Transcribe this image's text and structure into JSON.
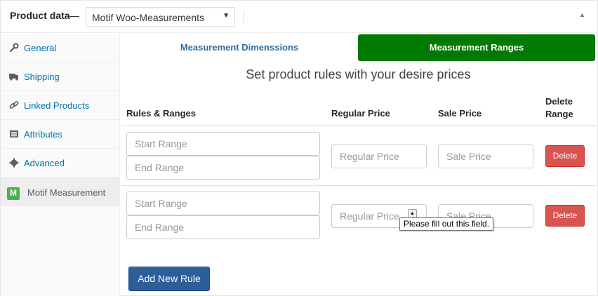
{
  "header": {
    "title": "Product data",
    "dash": "—",
    "product_type": "Motif Woo-Measurements",
    "select_arrow": "▼",
    "toggle_arrow": "▲"
  },
  "sidebar": {
    "items": [
      {
        "label": "General",
        "icon": "wrench-icon"
      },
      {
        "label": "Shipping",
        "icon": "truck-icon"
      },
      {
        "label": "Linked Products",
        "icon": "link-icon"
      },
      {
        "label": "Attributes",
        "icon": "list-icon"
      },
      {
        "label": "Advanced",
        "icon": "gear-icon"
      },
      {
        "label": "Motif Measurement",
        "icon": "motif-logo-icon"
      }
    ]
  },
  "tabs": {
    "dimensions": "Measurement Dimenssions",
    "ranges": "Measurement Ranges"
  },
  "subtitle": "Set product rules with your desire prices",
  "table": {
    "headers": {
      "rules": "Rules & Ranges",
      "regular": "Regular Price",
      "sale": "Sale Price",
      "delete_line1": "Delete",
      "delete_line2": "Range"
    },
    "rows": [
      {
        "start_placeholder": "Start Range",
        "end_placeholder": "End Range",
        "regular_placeholder": "Regular Price",
        "sale_placeholder": "Sale Price",
        "delete_label": "Delete"
      },
      {
        "start_placeholder": "Start Range",
        "end_placeholder": "End Range",
        "regular_placeholder": "Regular Price",
        "sale_placeholder": "Sale Price",
        "delete_label": "Delete"
      }
    ]
  },
  "add_rule_label": "Add New Rule",
  "tooltip": {
    "text": "Please fill out this field.",
    "tip_glyph": "▲"
  },
  "colors": {
    "active_tab": "#007a00",
    "delete_button": "#d9534f",
    "add_button": "#2d5e9a",
    "link": "#0073aa"
  }
}
